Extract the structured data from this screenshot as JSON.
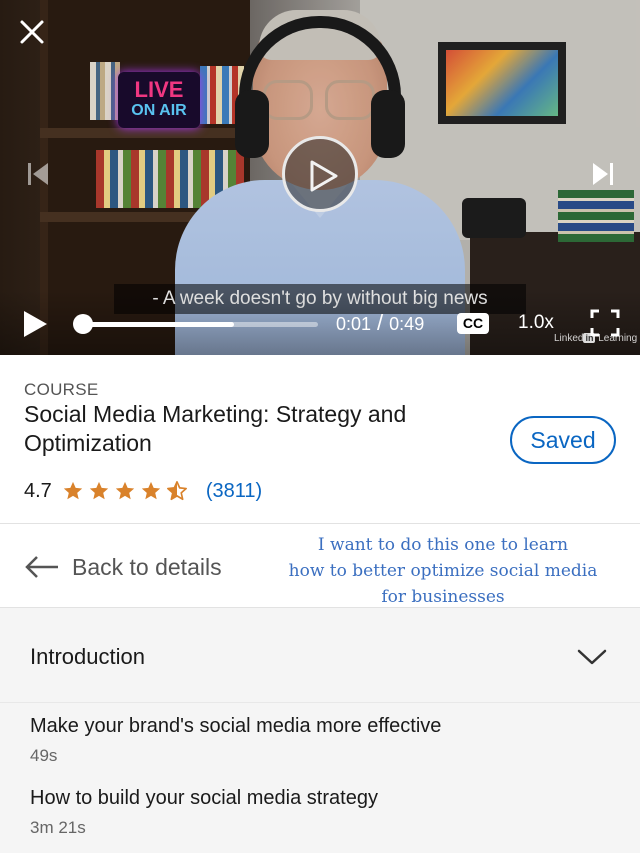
{
  "player": {
    "caption": "- A week doesn't go by without big news",
    "current_time": "0:01",
    "time_separator": "/",
    "duration": "0:49",
    "progress_fraction": 0.65,
    "cc_label": "CC",
    "speed": "1.0x",
    "watermark_brand": "Linked",
    "watermark_in": "in",
    "watermark_suffix": "Learning",
    "scene_sign_line1": "LIVE",
    "scene_sign_line2": "ON AIR"
  },
  "course": {
    "eyebrow": "COURSE",
    "title": "Social Media Marketing: Strategy and Optimization",
    "saved_label": "Saved",
    "rating_value": "4.7",
    "rating_stars": 4.5,
    "rating_count": "(3811)"
  },
  "nav": {
    "back_label": "Back to details"
  },
  "note": {
    "line1": "I want to do this one to learn",
    "line2": "how to better optimize social media",
    "line3": "for businesses"
  },
  "toc": {
    "section_title": "Introduction",
    "lessons": [
      {
        "title": "Make your brand's social media more effective",
        "duration": "49s"
      },
      {
        "title": "How to build your social media strategy",
        "duration": "3m 21s"
      }
    ]
  },
  "colors": {
    "accent": "#0a66c2",
    "star": "#d9822b",
    "note": "#3b6fc0"
  }
}
